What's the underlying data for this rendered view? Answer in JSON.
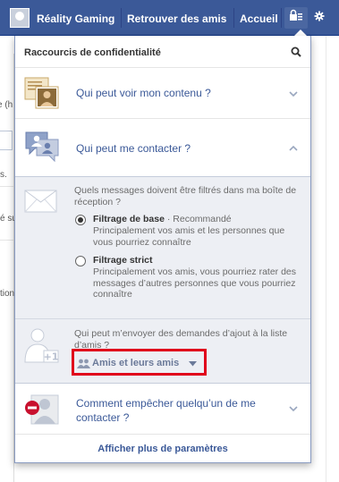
{
  "topbar": {
    "profile_name": "Réality Gaming",
    "find_friends": "Retrouver des amis",
    "home": "Accueil"
  },
  "background": {
    "frag1": "e (h",
    "frag2": "s.",
    "frag3": "é su",
    "frag4": "tion"
  },
  "panel": {
    "title": "Raccourcis de confidentialité",
    "rows": {
      "who_can_see": "Qui peut voir mon contenu ?",
      "who_can_contact": "Qui peut me contacter ?",
      "how_to_block": "Comment empêcher quelqu’un de me contacter ?"
    },
    "messages": {
      "question": "Quels messages doivent être filtrés dans ma boîte de réception ?",
      "basic_title": "Filtrage de base",
      "basic_recommended": " · Recommandé",
      "basic_desc": "Principalement vos amis et les personnes que vous pourriez connaître",
      "strict_title": "Filtrage strict",
      "strict_desc": "Principalement vos amis, vous pourriez rater des messages d’autres personnes que vous pourriez connaître"
    },
    "friend_requests": {
      "question": "Qui peut m’envoyer des demandes d’ajout à la liste d’amis ?",
      "audience": "Amis et leurs amis"
    },
    "footer_link": "Afficher plus de paramètres"
  },
  "colors": {
    "brand": "#3b5998",
    "highlight_border": "#e0001b",
    "expanded_bg": "#edeff4"
  }
}
